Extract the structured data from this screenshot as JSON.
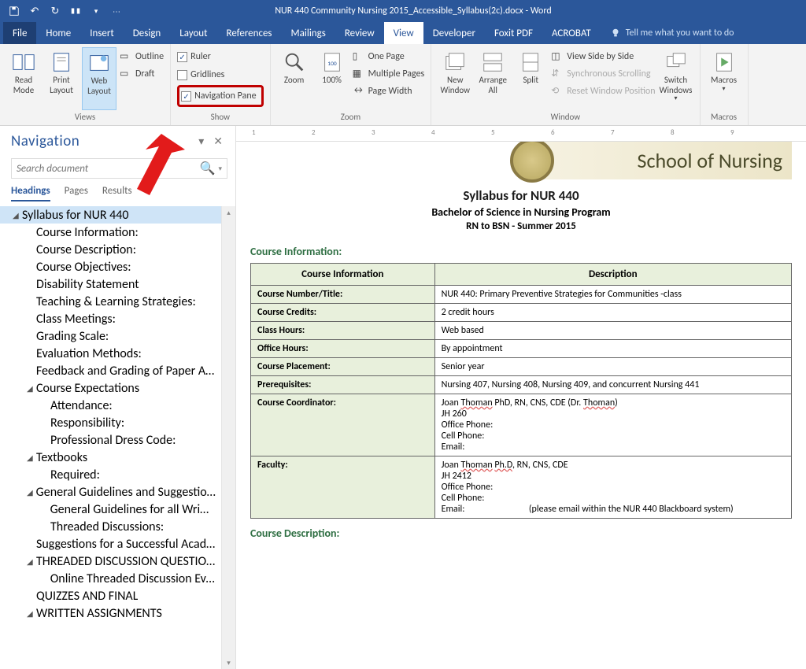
{
  "title": "NUR 440 Community Nursing 2015_Accessible_Syllabus(2c).docx - Word",
  "menu": {
    "file": "File",
    "home": "Home",
    "insert": "Insert",
    "design": "Design",
    "layout": "Layout",
    "references": "References",
    "mailings": "Mailings",
    "review": "Review",
    "view": "View",
    "developer": "Developer",
    "foxit": "Foxit PDF",
    "acrobat": "ACROBAT",
    "tellme": "Tell me what you want to do"
  },
  "ribbon": {
    "views": {
      "read": "Read Mode",
      "print": "Print Layout",
      "web": "Web Layout",
      "outline": "Outline",
      "draft": "Draft",
      "label": "Views"
    },
    "show": {
      "ruler": "Ruler",
      "gridlines": "Gridlines",
      "navpane": "Navigation Pane",
      "label": "Show"
    },
    "zoom": {
      "zoom": "Zoom",
      "pct": "100%",
      "onepage": "One Page",
      "multi": "Multiple Pages",
      "width": "Page Width",
      "label": "Zoom"
    },
    "window": {
      "new": "New Window",
      "arrange": "Arrange All",
      "split": "Split",
      "side": "View Side by Side",
      "sync": "Synchronous Scrolling",
      "reset": "Reset Window Position",
      "switch": "Switch Windows",
      "label": "Window"
    },
    "macros": {
      "macros": "Macros",
      "label": "Macros"
    }
  },
  "nav": {
    "title": "Navigation",
    "search_ph": "Search document",
    "tabs": {
      "headings": "Headings",
      "pages": "Pages",
      "results": "Results"
    },
    "items": [
      {
        "t": "Syllabus for NUR 440",
        "l": 0,
        "caret": true,
        "sel": true
      },
      {
        "t": "Course Information:",
        "l": 1
      },
      {
        "t": "Course Description:",
        "l": 1
      },
      {
        "t": "Course Objectives:",
        "l": 1
      },
      {
        "t": "Disability Statement",
        "l": 1
      },
      {
        "t": "Teaching & Learning Strategies:",
        "l": 1
      },
      {
        "t": "Class Meetings:",
        "l": 1
      },
      {
        "t": "Grading Scale:",
        "l": 1
      },
      {
        "t": "Evaluation Methods:",
        "l": 1
      },
      {
        "t": "Feedback and Grading of Paper As…",
        "l": 1
      },
      {
        "t": "Course Expectations",
        "l": 1,
        "caret": true
      },
      {
        "t": "Attendance:",
        "l": 2
      },
      {
        "t": "Responsibility:",
        "l": 2
      },
      {
        "t": "Professional Dress Code:",
        "l": 2
      },
      {
        "t": "Textbooks",
        "l": 1,
        "caret": true
      },
      {
        "t": "Required:",
        "l": 2
      },
      {
        "t": "General Guidelines and Suggestion…",
        "l": 1,
        "caret": true
      },
      {
        "t": "General Guidelines for all Writte…",
        "l": 2
      },
      {
        "t": "Threaded Discussions:",
        "l": 2
      },
      {
        "t": "Suggestions for a Successful Acad…",
        "l": 1
      },
      {
        "t": "THREADED DISCUSSION QUESTIO…",
        "l": 1,
        "caret": true
      },
      {
        "t": "Online Threaded Discussion Eva…",
        "l": 2
      },
      {
        "t": "QUIZZES AND FINAL",
        "l": 1
      },
      {
        "t": "WRITTEN ASSIGNMENTS",
        "l": 1,
        "caret": true
      }
    ]
  },
  "doc": {
    "banner": "School of Nursing",
    "h1": "Syllabus for NUR 440",
    "h2": "Bachelor of Science in Nursing Program",
    "h3": "RN to BSN  -  Summer 2015",
    "sec1": "Course Information:",
    "th1": "Course Information",
    "th2": "Description",
    "rows": [
      {
        "k": "Course Number/Title:",
        "v": "NUR 440: Primary Preventive Strategies for Communities -class"
      },
      {
        "k": "Course Credits:",
        "v": "2 credit hours"
      },
      {
        "k": "Class Hours:",
        "v": "Web based"
      },
      {
        "k": "Office Hours:",
        "v": "By appointment"
      },
      {
        "k": "Course Placement:",
        "v": "Senior year"
      },
      {
        "k": "Prerequisites:",
        "v": "Nursing 407, Nursing 408, Nursing 409, and concurrent Nursing 441"
      },
      {
        "k": "Course Coordinator:",
        "v_html": "Joan <span class='underline-red'>Thoman</span> PhD, RN, CNS, CDE (Dr. <span class='underline-red'>Thoman</span>)<br>JH 260<br>Office Phone:<br>Cell Phone:<br>Email:"
      },
      {
        "k": "Faculty:",
        "v_html": "Joan <span class='underline-red'>Thoman</span> <span class='underline-red'>Ph.D</span>, RN, CNS, CDE<br>JH 2412<br>Office Phone:<br>Cell Phone:<br>Email: &nbsp;&nbsp;&nbsp;&nbsp;&nbsp;&nbsp;&nbsp;&nbsp;&nbsp;&nbsp;&nbsp;&nbsp;&nbsp;&nbsp;&nbsp;&nbsp;&nbsp;&nbsp;&nbsp;&nbsp;&nbsp;&nbsp;&nbsp;&nbsp;&nbsp;&nbsp;&nbsp;&nbsp;&nbsp;(please email within the NUR 440 Blackboard system)"
      }
    ],
    "sec2": "Course Description:"
  },
  "ruler_marks": [
    "1",
    "2",
    "3",
    "4",
    "5",
    "6",
    "7",
    "8",
    "9"
  ]
}
